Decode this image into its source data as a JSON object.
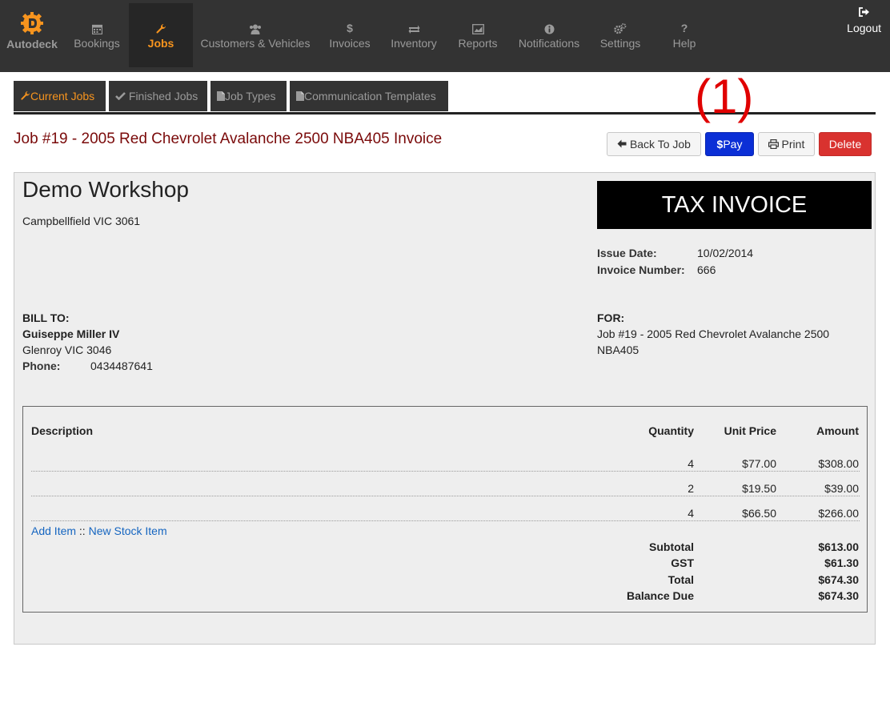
{
  "brand": {
    "name": "Autodeck",
    "color": "#f7941e"
  },
  "nav": {
    "items": [
      {
        "label": "Bookings",
        "icon": "calendar-icon"
      },
      {
        "label": "Jobs",
        "icon": "wrench-icon",
        "active": true
      },
      {
        "label": "Customers & Vehicles",
        "icon": "users-icon"
      },
      {
        "label": "Invoices",
        "icon": "dollar-icon"
      },
      {
        "label": "Inventory",
        "icon": "transfer-icon"
      },
      {
        "label": "Reports",
        "icon": "chart-icon"
      },
      {
        "label": "Notifications",
        "icon": "info-icon"
      },
      {
        "label": "Settings",
        "icon": "gears-icon"
      },
      {
        "label": "Help",
        "icon": "question-icon"
      }
    ],
    "logout": "Logout",
    "dollar_glyph": "$",
    "question_glyph": "?"
  },
  "tabs": [
    {
      "label": "Current Jobs",
      "icon": "wrench-icon",
      "active": true
    },
    {
      "label": "Finished Jobs",
      "icon": "check-icon"
    },
    {
      "label": "Job Types",
      "icon": "file-icon"
    },
    {
      "label": "Communication Templates",
      "icon": "file-icon"
    }
  ],
  "annotation": "(1)",
  "page_title": "Job #19 - 2005 Red Chevrolet Avalanche 2500 NBA405 Invoice",
  "actions": {
    "back": "Back To Job",
    "pay": "Pay",
    "pay_glyph": "$",
    "print": "Print",
    "delete": "Delete"
  },
  "invoice": {
    "business_name": "Demo Workshop",
    "business_address": "Campbellfield VIC 3061",
    "banner": "TAX INVOICE",
    "issue_date_label": "Issue Date:",
    "issue_date": "10/02/2014",
    "invoice_number_label": "Invoice Number:",
    "invoice_number": "666",
    "bill_to_label": "BILL TO:",
    "customer_name": "Guiseppe Miller IV",
    "customer_address": "Glenroy VIC 3046",
    "phone_label": "Phone:",
    "phone": "0434487641",
    "for_label": "FOR:",
    "for_line1": "Job #19 - 2005 Red Chevrolet Avalanche 2500",
    "for_line2": "NBA405",
    "columns": {
      "description": "Description",
      "quantity": "Quantity",
      "unit_price": "Unit Price",
      "amount": "Amount"
    },
    "lines": [
      {
        "description": "",
        "quantity": "4",
        "unit_price": "$77.00",
        "amount": "$308.00"
      },
      {
        "description": "",
        "quantity": "2",
        "unit_price": "$19.50",
        "amount": "$39.00"
      },
      {
        "description": "",
        "quantity": "4",
        "unit_price": "$66.50",
        "amount": "$266.00"
      }
    ],
    "add_item": "Add Item",
    "link_separator": "::",
    "new_stock_item": "New Stock Item",
    "totals": {
      "subtotal_label": "Subtotal",
      "subtotal": "$613.00",
      "gst_label": "GST",
      "gst": "$61.30",
      "total_label": "Total",
      "total": "$674.30",
      "balance_label": "Balance Due",
      "balance": "$674.30"
    }
  }
}
